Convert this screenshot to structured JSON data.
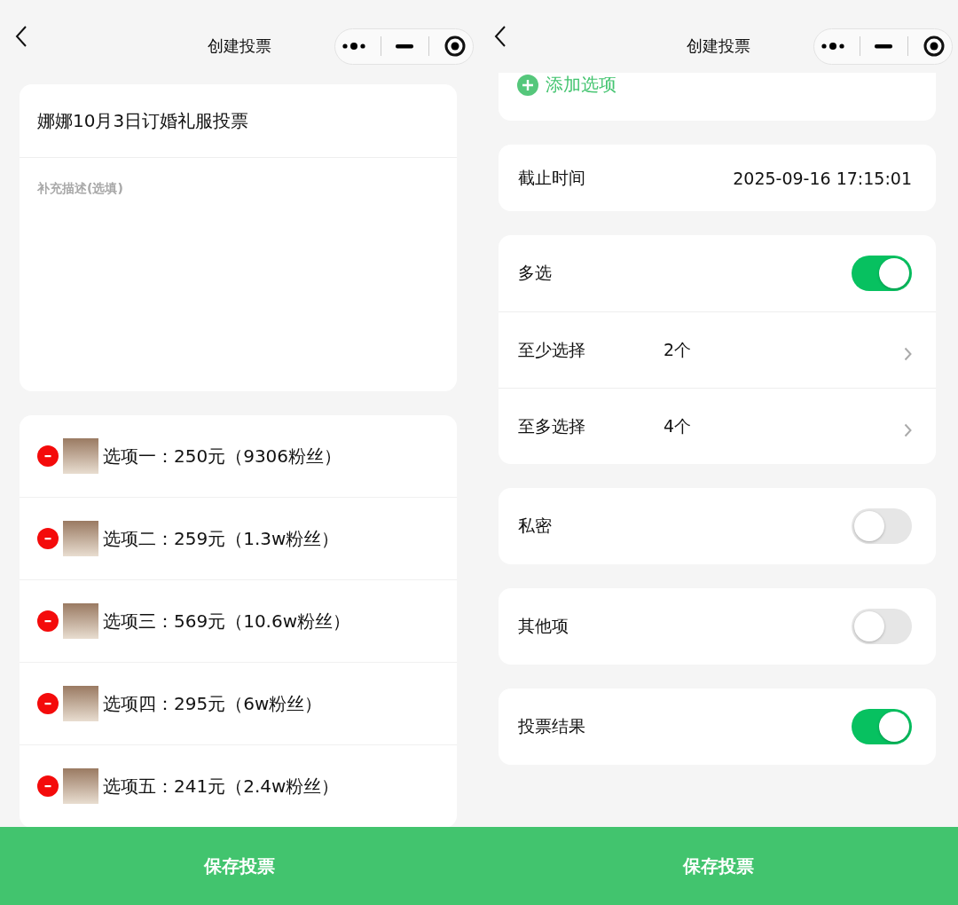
{
  "screens": [
    {
      "nav": {
        "title": "创建投票"
      },
      "title_field": {
        "value": "娜娜10月3日订婚礼服投票"
      },
      "description_field": {
        "placeholder": "补充描述(选填)"
      },
      "options": [
        {
          "label": "选项一：250元（9306粉丝）"
        },
        {
          "label": "选项二：259元（1.3w粉丝）"
        },
        {
          "label": "选项三：569元（10.6w粉丝）"
        },
        {
          "label": "选项四：295元（6w粉丝）"
        },
        {
          "label": "选项五：241元（2.4w粉丝）"
        }
      ],
      "save_button": "保存投票"
    },
    {
      "nav": {
        "title": "创建投票"
      },
      "add_option": "添加选项",
      "setting_groups": [
        {
          "rows": [
            {
              "kind": "value",
              "label": "截止时间",
              "value": "2025-09-16 17:15:01"
            }
          ]
        },
        {
          "rows": [
            {
              "kind": "toggle",
              "label": "多选",
              "on": true
            },
            {
              "kind": "picker",
              "label": "至少选择",
              "value": "2个"
            },
            {
              "kind": "picker",
              "label": "至多选择",
              "value": "4个"
            }
          ]
        },
        {
          "rows": [
            {
              "kind": "toggle",
              "label": "私密",
              "on": false
            }
          ]
        },
        {
          "rows": [
            {
              "kind": "toggle",
              "label": "其他项",
              "on": false
            }
          ]
        },
        {
          "rows": [
            {
              "kind": "toggle",
              "label": "投票结果",
              "on": true
            }
          ]
        }
      ],
      "save_button": "保存投票"
    }
  ]
}
